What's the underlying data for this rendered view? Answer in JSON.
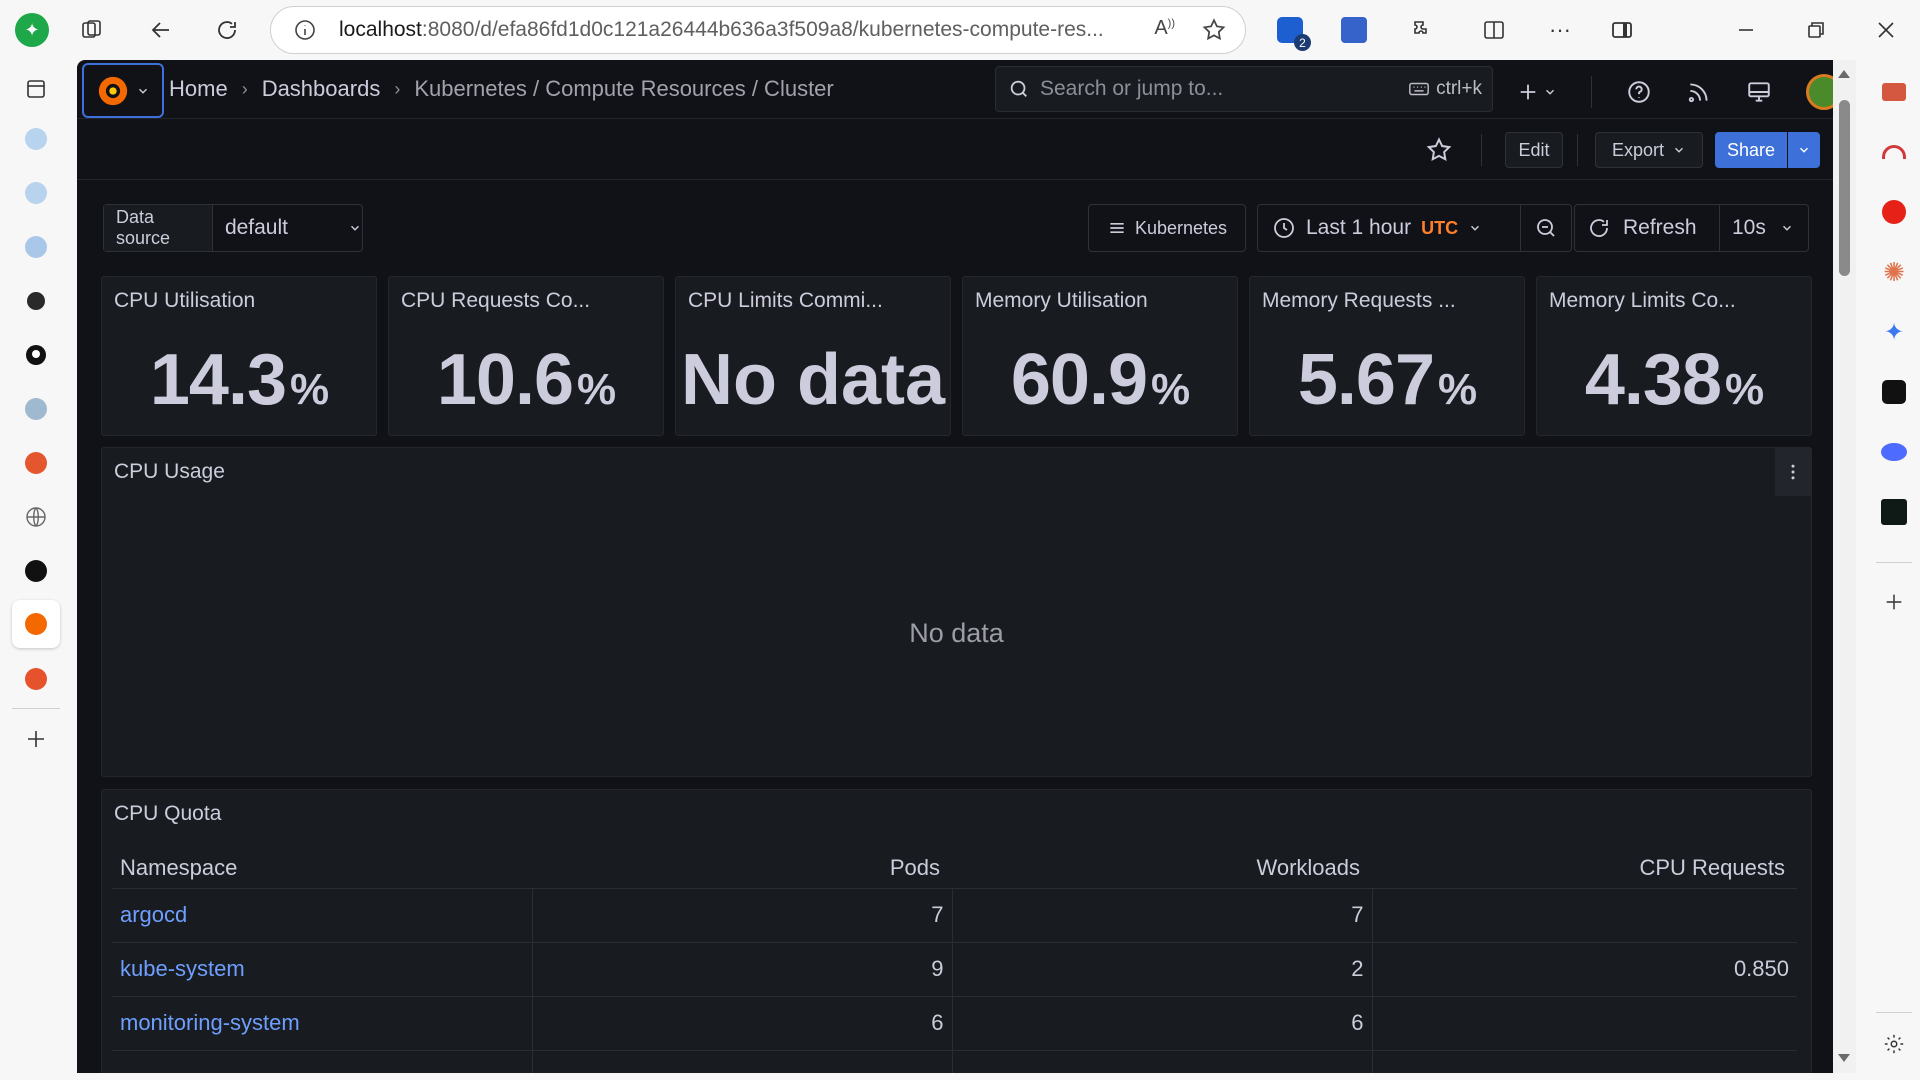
{
  "browser": {
    "url_host": "localhost",
    "url_path": ":8080/d/efa86fd1d0c121a26444b636a3f509a8/kubernetes-compute-res...",
    "extension_badge": "2"
  },
  "grafana": {
    "breadcrumbs": {
      "home": "Home",
      "dashboards": "Dashboards",
      "current": "Kubernetes / Compute Resources / Cluster"
    },
    "search": {
      "placeholder": "Search or jump to...",
      "shortcut": "ctrl+k"
    },
    "toolbar": {
      "edit": "Edit",
      "export": "Export",
      "share": "Share"
    },
    "variables": {
      "datasource_label": "Data source",
      "datasource_value": "default"
    },
    "controls": {
      "kubernetes": "Kubernetes",
      "time_range": "Last 1 hour",
      "timezone": "UTC",
      "refresh": "Refresh",
      "interval": "10s"
    },
    "stats": [
      {
        "title": "CPU Utilisation",
        "value": "14.3",
        "unit": "%"
      },
      {
        "title": "CPU Requests Co...",
        "value": "10.6",
        "unit": "%"
      },
      {
        "title": "CPU Limits Commi...",
        "value": "No data",
        "unit": ""
      },
      {
        "title": "Memory Utilisation",
        "value": "60.9",
        "unit": "%"
      },
      {
        "title": "Memory Requests ...",
        "value": "5.67",
        "unit": "%"
      },
      {
        "title": "Memory Limits Co...",
        "value": "4.38",
        "unit": "%"
      }
    ],
    "cpu_usage": {
      "title": "CPU Usage",
      "empty_text": "No data"
    },
    "cpu_quota": {
      "title": "CPU Quota",
      "columns": [
        "Namespace",
        "Pods",
        "Workloads",
        "CPU Requests"
      ],
      "rows": [
        {
          "namespace": "argocd",
          "pods": "7",
          "workloads": "7",
          "cpu_requests": ""
        },
        {
          "namespace": "kube-system",
          "pods": "9",
          "workloads": "2",
          "cpu_requests": "0.850"
        },
        {
          "namespace": "monitoring-system",
          "pods": "6",
          "workloads": "6",
          "cpu_requests": ""
        }
      ]
    }
  },
  "colors": {
    "grafana_bg": "#111217",
    "panel_bg": "#181b1f",
    "primary": "#3d71d9",
    "link": "#6e9fff",
    "timezone": "#ff7f2a"
  }
}
